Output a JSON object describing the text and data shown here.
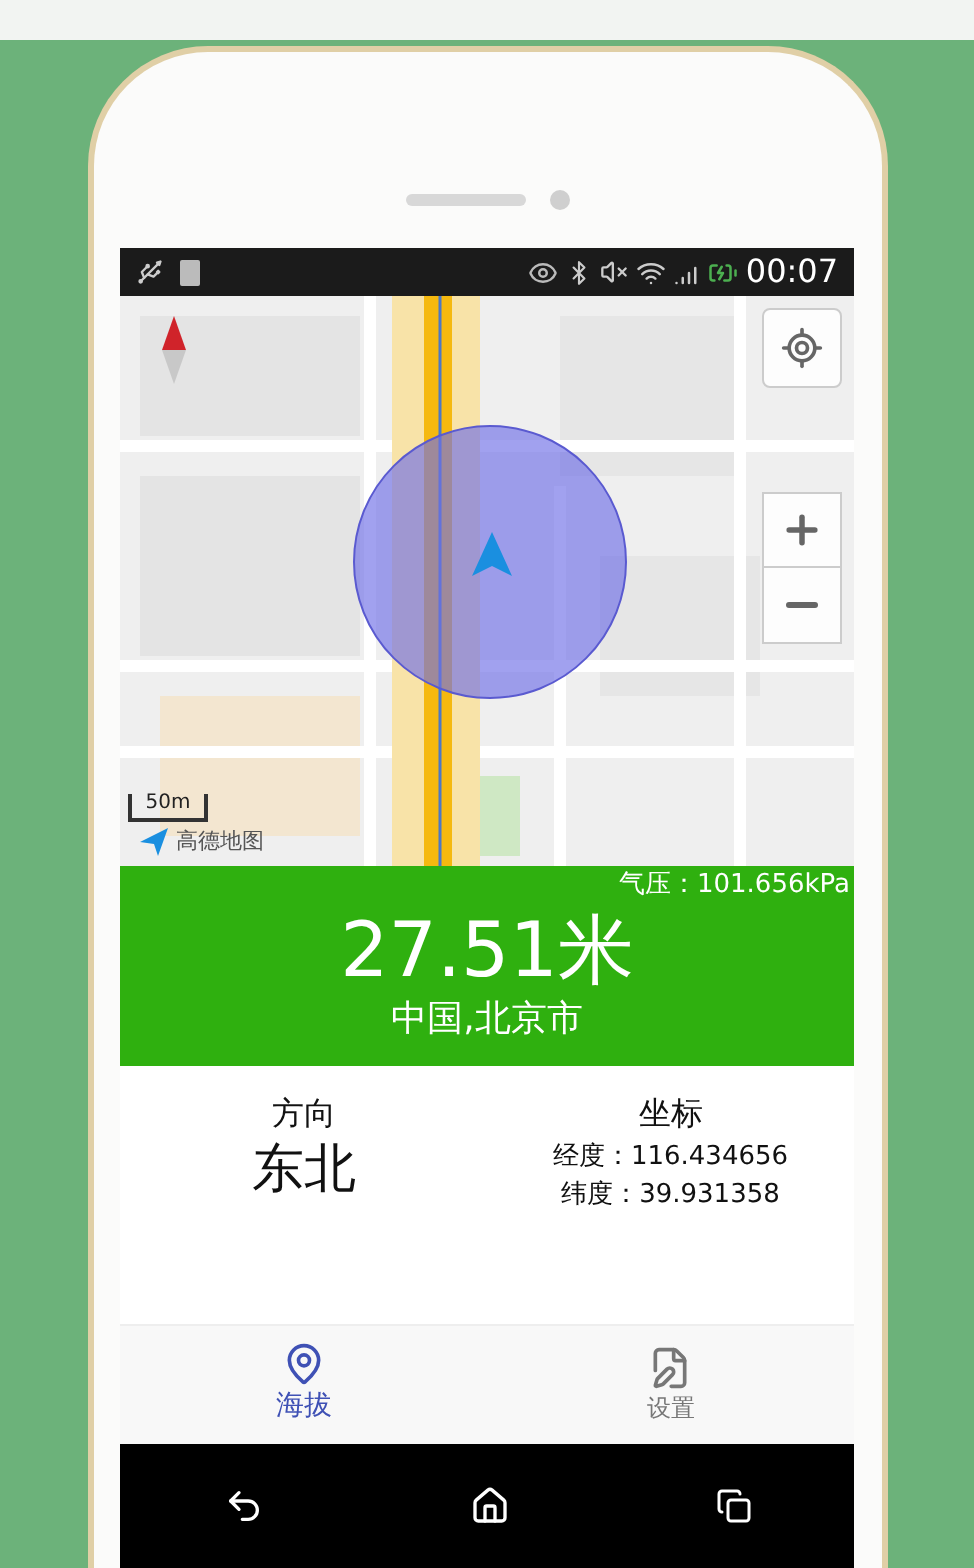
{
  "status_bar": {
    "time": "00:07"
  },
  "map": {
    "scale": "50m",
    "logo": "高德地图"
  },
  "pressure": "气压：101.656kPa",
  "altitude": "27.51米",
  "location": "中国,北京市",
  "direction": {
    "label": "方向",
    "value": "东北"
  },
  "coordinates": {
    "label": "坐标",
    "longitude": "经度：116.434656",
    "latitude": "纬度：39.931358"
  },
  "tabs": [
    {
      "label": "海拔",
      "selected": true,
      "kind": "pin"
    },
    {
      "label": "设置",
      "selected": false,
      "kind": "document"
    }
  ]
}
